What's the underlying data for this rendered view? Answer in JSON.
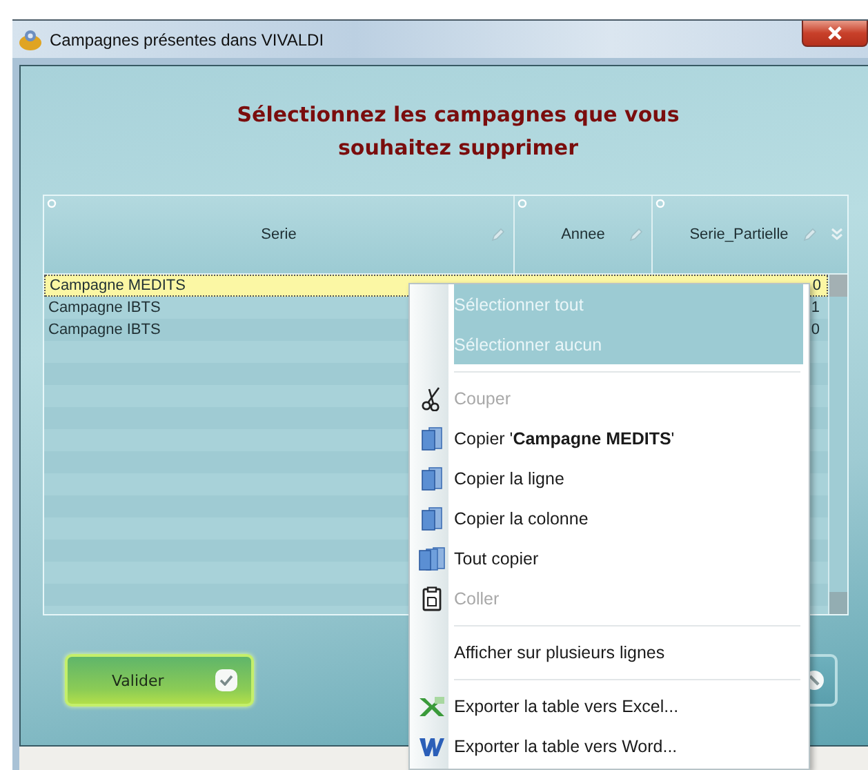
{
  "window": {
    "title": "Campagnes présentes dans VIVALDI"
  },
  "heading": "Sélectionnez les campagnes que vous souhaitez supprimer",
  "table": {
    "columns": [
      "Serie",
      "Annee",
      "Serie_Partielle"
    ],
    "rows": [
      {
        "serie": "Campagne MEDITS",
        "serie_partielle": "0",
        "selected": true
      },
      {
        "serie": "Campagne IBTS",
        "serie_partielle": "1",
        "selected": false
      },
      {
        "serie": "Campagne IBTS",
        "serie_partielle": "0",
        "selected": false
      }
    ]
  },
  "buttons": [
    {
      "kind": "ok",
      "label": "Valider"
    },
    {
      "kind": "cancel"
    }
  ],
  "context_menu": {
    "items": [
      {
        "kind": "plain",
        "label": "Sélectionner tout",
        "highlighted": true,
        "disabled": false
      },
      {
        "kind": "plain",
        "label": "Sélectionner aucun",
        "highlighted": true,
        "disabled": false
      },
      {
        "kind": "separator"
      },
      {
        "kind": "cut",
        "label": "Couper",
        "highlighted": false,
        "disabled": true
      },
      {
        "kind": "copy",
        "label": "Copier '**Campagne MEDITS**'",
        "highlighted": false,
        "disabled": false
      },
      {
        "kind": "copy",
        "label": "Copier la ligne",
        "highlighted": false,
        "disabled": false
      },
      {
        "kind": "copy",
        "label": "Copier la colonne",
        "highlighted": false,
        "disabled": false
      },
      {
        "kind": "copy_all",
        "label": "Tout copier",
        "highlighted": false,
        "disabled": false
      },
      {
        "kind": "paste",
        "label": "Coller",
        "highlighted": false,
        "disabled": true
      },
      {
        "kind": "separator"
      },
      {
        "kind": "plain",
        "label": "Afficher sur plusieurs lignes",
        "highlighted": false,
        "disabled": false
      },
      {
        "kind": "separator"
      },
      {
        "kind": "excel",
        "label": "Exporter la table vers Excel...",
        "highlighted": false,
        "disabled": false
      },
      {
        "kind": "word",
        "label": "Exporter la table vers Word...",
        "highlighted": false,
        "disabled": false
      }
    ]
  }
}
